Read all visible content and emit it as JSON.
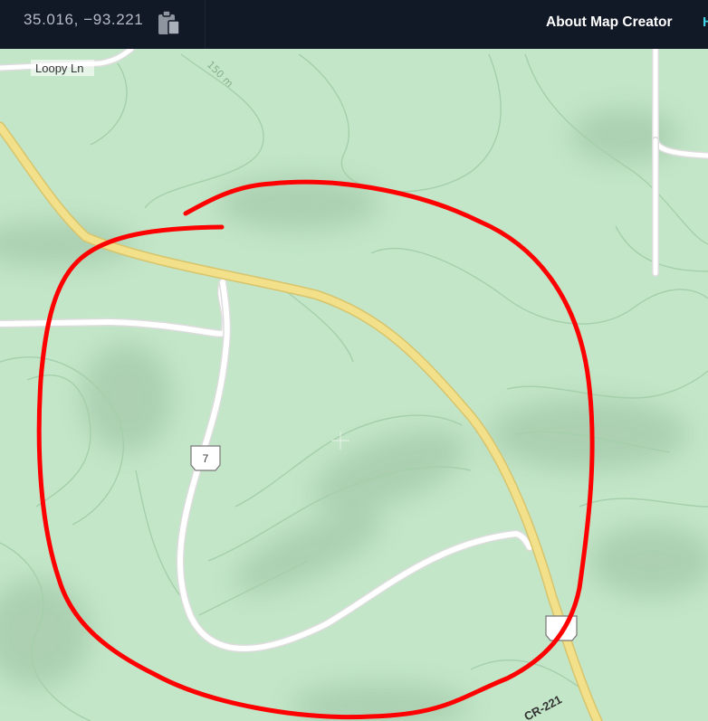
{
  "header": {
    "coordinates": "35.016, −93.221",
    "copy_icon": "clipboard-icon",
    "about_link": "About Map Creator",
    "cut_off_link": "H"
  },
  "map": {
    "road_labels": {
      "loopy_ln": "Loopy Ln",
      "route_7": "7",
      "cr_221": "CR-221"
    },
    "contour_label": "150 m",
    "colors": {
      "land": "#c3e6c8",
      "highway": "#f2e08a",
      "road": "#ffffff",
      "annotation": "#ff0000",
      "header": "#111826"
    }
  }
}
